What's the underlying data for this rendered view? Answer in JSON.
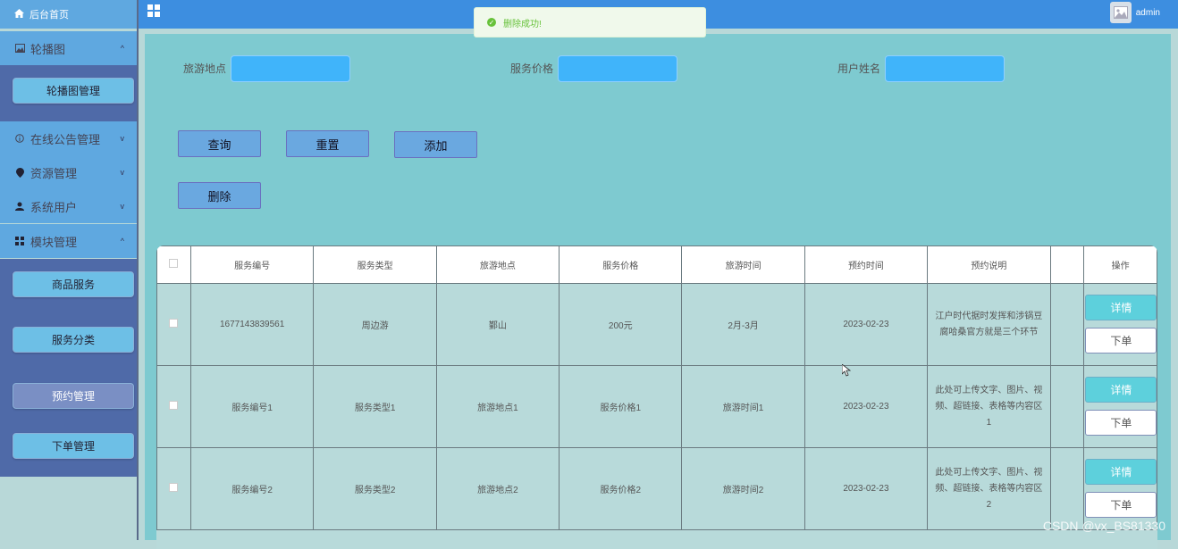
{
  "sidebar": {
    "home_label": "后台首页",
    "menus": [
      {
        "label": "轮播图",
        "icon": "image-icon",
        "expanded": true
      },
      {
        "label": "在线公告管理",
        "icon": "info-circle-icon",
        "expanded": false
      },
      {
        "label": "资源管理",
        "icon": "location-pin-icon",
        "expanded": false
      },
      {
        "label": "系统用户",
        "icon": "user-icon",
        "expanded": false
      },
      {
        "label": "模块管理",
        "icon": "grid-icon",
        "expanded": true
      }
    ],
    "carousel_sub": [
      "轮播图管理"
    ],
    "module_sub": [
      "商品服务",
      "服务分类",
      "预约管理",
      "下单管理"
    ],
    "active_item": "预约管理"
  },
  "header": {
    "title": "",
    "username": "admin"
  },
  "toast": {
    "message": "删除成功!"
  },
  "filters": [
    {
      "label": "旅游地点",
      "value": ""
    },
    {
      "label": "服务价格",
      "value": ""
    },
    {
      "label": "用户姓名",
      "value": ""
    }
  ],
  "actions": {
    "search": "查询",
    "reset": "重置",
    "add": "添加",
    "delete": "删除"
  },
  "table": {
    "columns": [
      "服务编号",
      "服务类型",
      "旅游地点",
      "服务价格",
      "旅游时间",
      "预约时间",
      "预约说明",
      "",
      "操作"
    ],
    "rows": [
      {
        "id": "1677143839561",
        "type": "周边游",
        "place": "鄞山",
        "price": "200元",
        "travel_time": "2月-3月",
        "booking_time": "2023-02-23",
        "desc": "江户时代据时发挥和涉锅豆腐哈桑官方就是三个环节"
      },
      {
        "id": "服务编号1",
        "type": "服务类型1",
        "place": "旅游地点1",
        "price": "服务价格1",
        "travel_time": "旅游时间1",
        "booking_time": "2023-02-23",
        "desc": "此处可上传文字、图片、视频、超链接、表格等内容区1"
      },
      {
        "id": "服务编号2",
        "type": "服务类型2",
        "place": "旅游地点2",
        "price": "服务价格2",
        "travel_time": "旅游时间2",
        "booking_time": "2023-02-23",
        "desc": "此处可上传文字、图片、视频、超链接、表格等内容区2"
      }
    ],
    "detail_label": "详情",
    "order_label": "下单"
  },
  "watermark": "CSDN @vx_BS81330",
  "colors": {
    "header": "#3d8ee0",
    "sidebar_menu": "#5fa8e0",
    "sidebar_sub": "#4f6aa8",
    "main_bg": "#7ecad0",
    "input_bg": "#40b4fa",
    "success": "#67c23a"
  }
}
